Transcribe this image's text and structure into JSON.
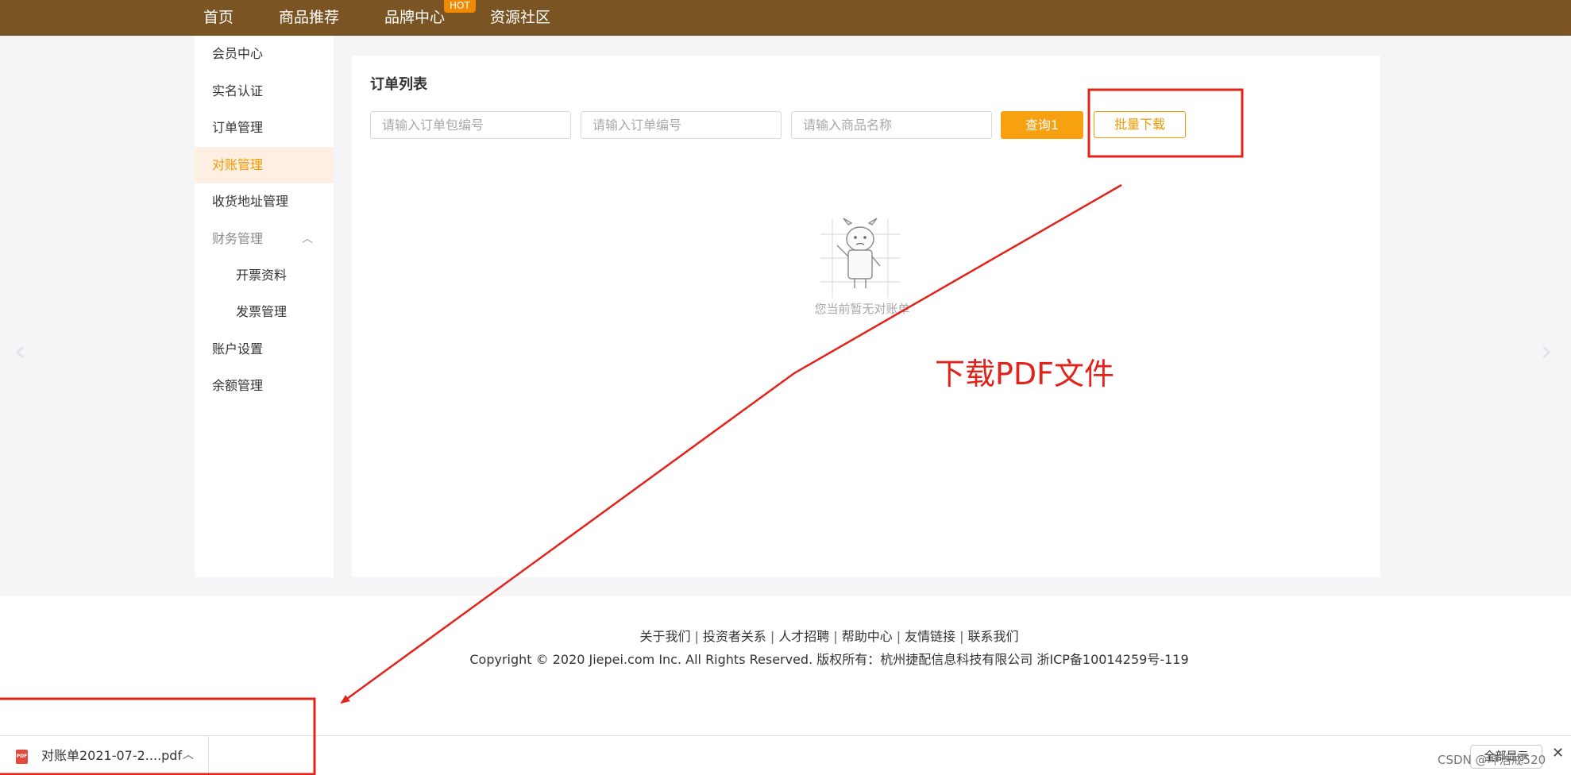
{
  "nav": {
    "home": "首页",
    "recommend": "商品推荐",
    "brand": "品牌中心",
    "hot_badge": "HOT",
    "community": "资源社区"
  },
  "sidebar": {
    "items": [
      {
        "label": "会员中心"
      },
      {
        "label": "实名认证"
      },
      {
        "label": "订单管理"
      },
      {
        "label": "对账管理"
      },
      {
        "label": "收货地址管理"
      },
      {
        "label": "财务管理"
      },
      {
        "label": "开票资料"
      },
      {
        "label": "发票管理"
      },
      {
        "label": "账户设置"
      },
      {
        "label": "余额管理"
      }
    ]
  },
  "main": {
    "title": "订单列表",
    "filters": {
      "package_placeholder": "请输入订单包编号",
      "order_placeholder": "请输入订单编号",
      "product_placeholder": "请输入商品名称"
    },
    "query_button": "查询1",
    "batch_download_button": "批量下载",
    "empty_text": "您当前暂无对账单"
  },
  "annotation": {
    "text": "下载PDF文件",
    "color": "#e2231a"
  },
  "footer": {
    "links": [
      "关于我们",
      "投资者关系",
      "人才招聘",
      "帮助中心",
      "友情链接",
      "联系我们"
    ],
    "copyright": "Copyright © 2020 Jiepei.com Inc. All Rights Reserved. 版权所有：杭州捷配信息科技有限公司  浙ICP备10014259号-119"
  },
  "download_bar": {
    "file_name": "对账单2021-07-2....pdf",
    "file_icon": "pdf-file-icon",
    "show_all": "全部显示"
  },
  "watermark": "CSDN @呻浩戒520",
  "colors": {
    "nav_bg": "#7b5424",
    "accent": "#f39800",
    "query_bg": "#f7a010",
    "annotation": "#e2231a"
  }
}
